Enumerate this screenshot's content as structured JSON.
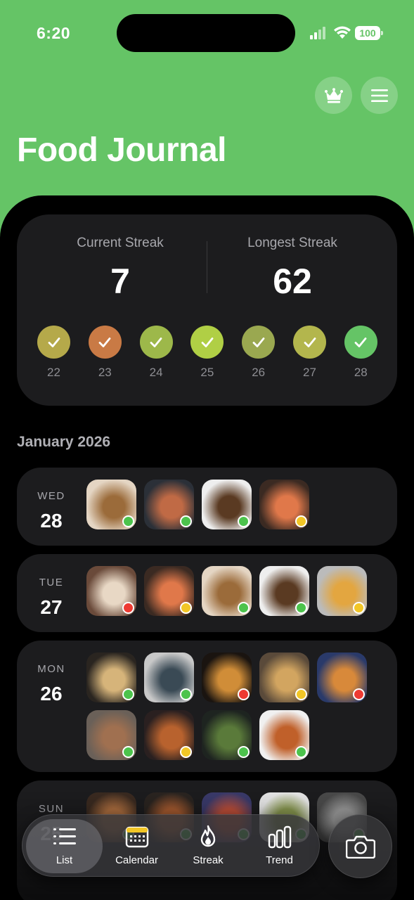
{
  "status_bar": {
    "time": "6:20",
    "battery": "100"
  },
  "header": {
    "title": "Food Journal",
    "crown_icon": "crown-icon",
    "menu_icon": "hamburger-menu-icon"
  },
  "streak": {
    "current_label": "Current Streak",
    "current_value": "7",
    "longest_label": "Longest Streak",
    "longest_value": "62",
    "days": [
      {
        "day": "22",
        "color": "#b5a94a"
      },
      {
        "day": "23",
        "color": "#c97a45"
      },
      {
        "day": "24",
        "color": "#9db84a"
      },
      {
        "day": "25",
        "color": "#b0cf45"
      },
      {
        "day": "26",
        "color": "#9aa850"
      },
      {
        "day": "27",
        "color": "#b3b64d"
      },
      {
        "day": "28",
        "color": "#65c466"
      }
    ]
  },
  "month_label": "January 2026",
  "entries": [
    {
      "dow": "WED",
      "dom": "28",
      "meals": [
        {
          "ind": "#4cc34c",
          "bg": "#e4d5c3,#9b6b3a"
        },
        {
          "ind": "#4cc34c",
          "bg": "#2b3038,#c06a45"
        },
        {
          "ind": "#4cc34c",
          "bg": "#eeeeee,#5a3a22"
        },
        {
          "ind": "#f2c626",
          "bg": "#3b2a22,#e0784a"
        }
      ]
    },
    {
      "dow": "TUE",
      "dom": "27",
      "meals": [
        {
          "ind": "#ee3a32",
          "bg": "#6a4a3a,#e8d8c5"
        },
        {
          "ind": "#f2c626",
          "bg": "#3b2a22,#e0784a"
        },
        {
          "ind": "#4cc34c",
          "bg": "#e4d5c3,#9b6b3a"
        },
        {
          "ind": "#4cc34c",
          "bg": "#eeeeee,#5a3a22"
        },
        {
          "ind": "#f2c626",
          "bg": "#bbbbbb,#e3a640"
        }
      ]
    },
    {
      "dow": "MON",
      "dom": "26",
      "meals": [
        {
          "ind": "#4cc34c",
          "bg": "#2a2520,#d6b47a"
        },
        {
          "ind": "#4cc34c",
          "bg": "#c8c8c8,#3a4a55"
        },
        {
          "ind": "#ee3a32",
          "bg": "#1a1410,#d08d38"
        },
        {
          "ind": "#f2c626",
          "bg": "#5a4a3a,#d2a560"
        },
        {
          "ind": "#ee3a32",
          "bg": "#2a3a6a,#d8893a"
        },
        {
          "ind": "#4cc34c",
          "bg": "#6a6058,#a07050"
        },
        {
          "ind": "#f2c626",
          "bg": "#2a2020,#b8622e"
        },
        {
          "ind": "#4cc34c",
          "bg": "#1e2420,#5a7a3a"
        },
        {
          "ind": "#4cc34c",
          "bg": "#f0f0f0,#c0602a"
        }
      ]
    },
    {
      "dow": "SUN",
      "dom": "25",
      "meals": [
        {
          "ind": "#4cc34c",
          "bg": "#3a2a20,#b07040"
        },
        {
          "ind": "#4cc34c",
          "bg": "#2a2420,#a85c30"
        },
        {
          "ind": "#4cc34c",
          "bg": "#3a3a6a,#c0503a"
        },
        {
          "ind": "#4cc34c",
          "bg": "#e8e8e8,#8a9a50"
        },
        {
          "ind": "#4cc34c",
          "bg": "#4a4a4a,#9a9a9a"
        }
      ]
    }
  ],
  "tabs": [
    {
      "label": "List",
      "icon": "list-icon",
      "active": true
    },
    {
      "label": "Calendar",
      "icon": "calendar-icon",
      "active": false
    },
    {
      "label": "Streak",
      "icon": "flame-icon",
      "active": false
    },
    {
      "label": "Trend",
      "icon": "bar-chart-icon",
      "active": false
    }
  ],
  "camera_icon": "camera-icon"
}
